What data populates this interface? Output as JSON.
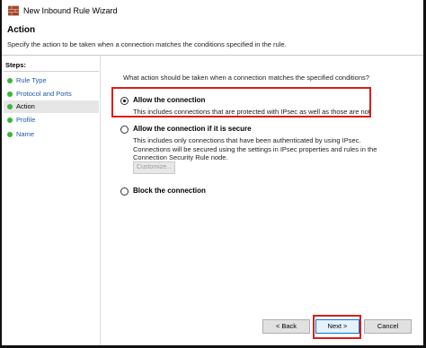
{
  "window": {
    "title": "New Inbound Rule Wizard"
  },
  "header": {
    "title": "Action",
    "subtitle": "Specify the action to be taken when a connection matches the conditions specified in the rule."
  },
  "steps": {
    "title": "Steps:",
    "items": [
      {
        "label": "Rule Type"
      },
      {
        "label": "Protocol and Ports"
      },
      {
        "label": "Action"
      },
      {
        "label": "Profile"
      },
      {
        "label": "Name"
      }
    ]
  },
  "main": {
    "question": "What action should be taken when a connection matches the specified conditions?",
    "options": [
      {
        "label": "Allow the connection",
        "description": "This includes connections that are protected with IPsec as well as those are not.",
        "selected": true
      },
      {
        "label": "Allow the connection if it is secure",
        "description": "This includes only connections that have been authenticated by using IPsec.  Connections will be secured using the settings in IPsec properties and rules in the Connection Security Rule node.",
        "selected": false
      },
      {
        "label": "Block the connection",
        "description": "",
        "selected": false
      }
    ],
    "customize_label": "Customize..."
  },
  "buttons": {
    "back": "< Back",
    "next": "Next >",
    "cancel": "Cancel"
  },
  "colors": {
    "highlight": "#d81e1e",
    "step_dot": "#3cb43c",
    "link": "#1e5aa8"
  }
}
